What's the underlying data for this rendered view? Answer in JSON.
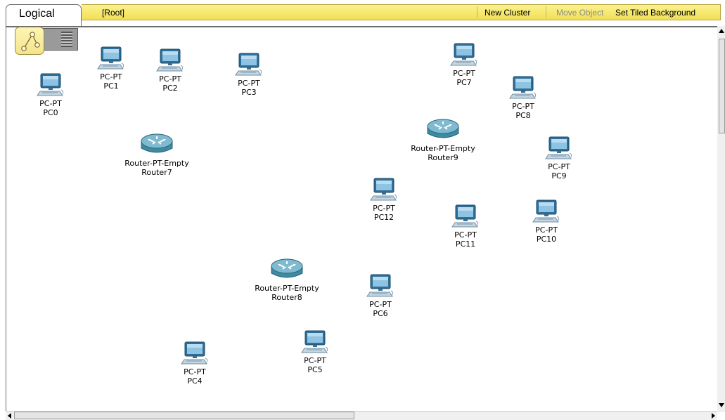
{
  "tabs": {
    "logical_label": "Logical"
  },
  "toolbar": {
    "root_label": "[Root]",
    "new_cluster": "New Cluster",
    "move_object": "Move Object",
    "set_tiled_background": "Set Tiled Background"
  },
  "colors": {
    "toolbar_yellow": "#f6e66e",
    "router_teal": "#5f9fb5",
    "pc_blue": "#3f7fa8"
  },
  "icons": {
    "navigation": "cluster-nav-icon",
    "pc": "pc-icon",
    "router": "router-icon"
  },
  "devices": [
    {
      "type": "PC-PT",
      "name": "PC0"
    },
    {
      "type": "PC-PT",
      "name": "PC1"
    },
    {
      "type": "PC-PT",
      "name": "PC2"
    },
    {
      "type": "PC-PT",
      "name": "PC3"
    },
    {
      "type": "PC-PT",
      "name": "PC7"
    },
    {
      "type": "PC-PT",
      "name": "PC8"
    },
    {
      "type": "Router-PT-Empty",
      "name": "Router9"
    },
    {
      "type": "Router-PT-Empty",
      "name": "Router7"
    },
    {
      "type": "PC-PT",
      "name": "PC9"
    },
    {
      "type": "PC-PT",
      "name": "PC12"
    },
    {
      "type": "PC-PT",
      "name": "PC11"
    },
    {
      "type": "PC-PT",
      "name": "PC10"
    },
    {
      "type": "Router-PT-Empty",
      "name": "Router8"
    },
    {
      "type": "PC-PT",
      "name": "PC6"
    },
    {
      "type": "PC-PT",
      "name": "PC5"
    },
    {
      "type": "PC-PT",
      "name": "PC4"
    }
  ]
}
